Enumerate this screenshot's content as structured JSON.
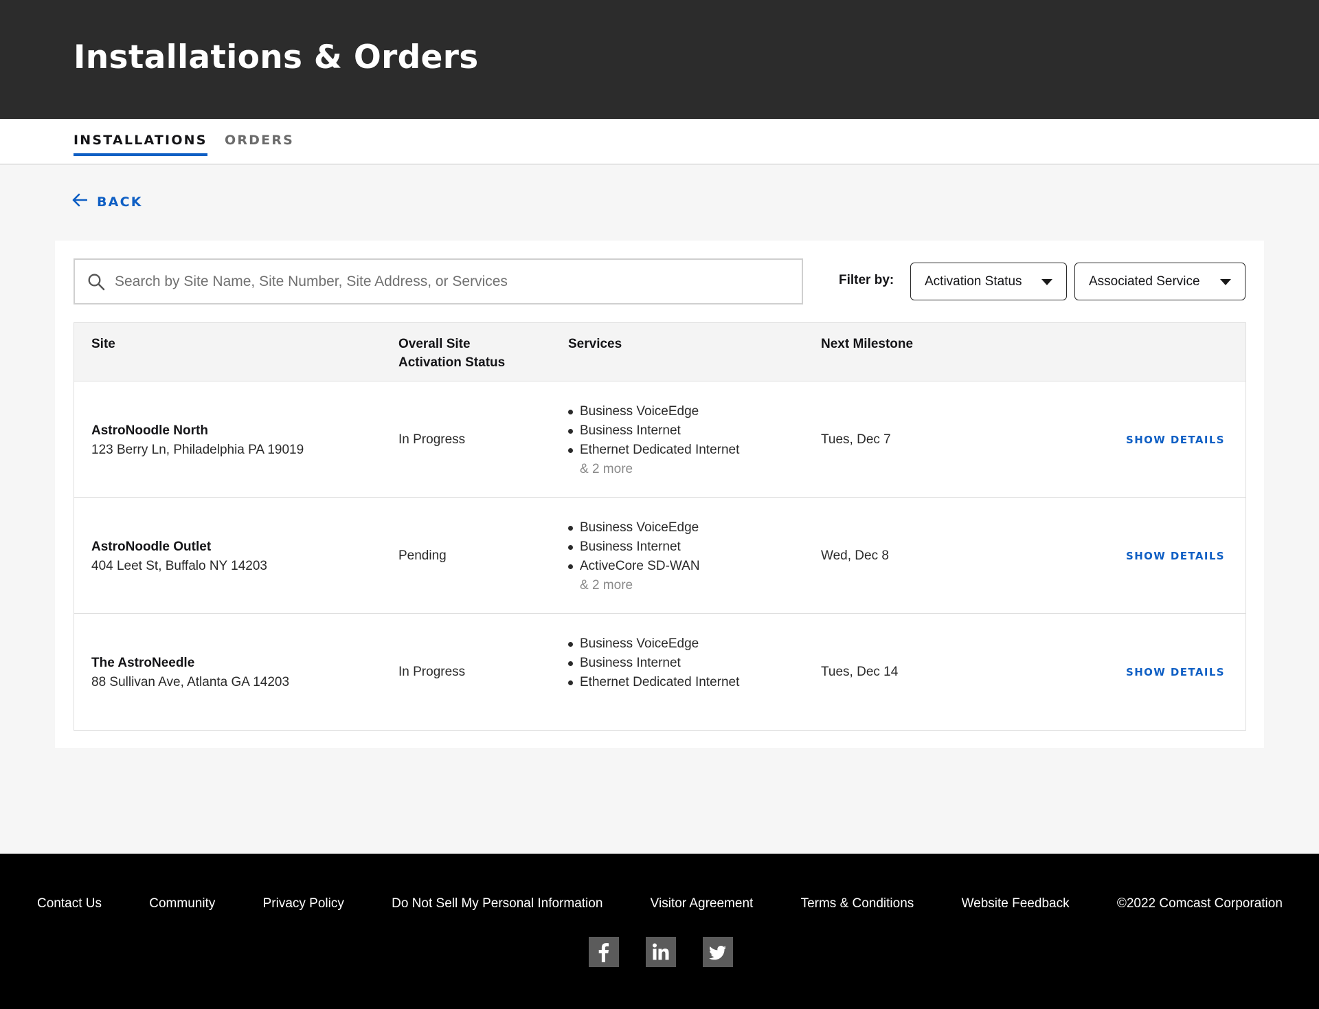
{
  "header": {
    "title": "Installations & Orders"
  },
  "tabs": [
    {
      "label": "INSTALLATIONS",
      "active": true
    },
    {
      "label": "ORDERS",
      "active": false
    }
  ],
  "back": {
    "label": "BACK",
    "icon": "arrow-left-icon"
  },
  "search": {
    "placeholder": "Search by Site Name, Site Number, Site Address, or Services",
    "value": "",
    "icon": "search-icon"
  },
  "filters": {
    "label": "Filter by:",
    "activation_status": {
      "value": "Activation Status",
      "icon": "caret-down-icon"
    },
    "associated_service": {
      "value": "Associated Service",
      "icon": "caret-down-icon"
    }
  },
  "table": {
    "columns": {
      "site": "Site",
      "status_line1": "Overall Site",
      "status_line2": "Activation Status",
      "services": "Services",
      "milestone": "Next Milestone"
    },
    "rows": [
      {
        "site_name": "AstroNoodle North",
        "address": "123 Berry Ln, Philadelphia PA 19019",
        "status": "In Progress",
        "services": [
          "Business VoiceEdge",
          "Business Internet",
          "Ethernet Dedicated Internet"
        ],
        "more": "& 2 more",
        "milestone": "Tues, Dec 7",
        "action": "SHOW DETAILS"
      },
      {
        "site_name": "AstroNoodle Outlet",
        "address": "404 Leet St, Buffalo NY 14203",
        "status": "Pending",
        "services": [
          "Business VoiceEdge",
          "Business Internet",
          "ActiveCore SD-WAN"
        ],
        "more": "& 2 more",
        "milestone": "Wed, Dec 8",
        "action": "SHOW DETAILS"
      },
      {
        "site_name": "The AstroNeedle",
        "address": "88 Sullivan Ave, Atlanta GA 14203",
        "status": "In Progress",
        "services": [
          "Business VoiceEdge",
          "Business Internet",
          "Ethernet Dedicated Internet"
        ],
        "more": "",
        "milestone": "Tues, Dec 14",
        "action": "SHOW DETAILS"
      }
    ]
  },
  "footer": {
    "links": [
      "Contact Us",
      "Community",
      "Privacy Policy",
      "Do Not Sell My Personal Information",
      "Visitor Agreement",
      "Terms & Conditions",
      "Website Feedback"
    ],
    "copyright": "©2022 Comcast Corporation",
    "social": [
      "facebook-icon",
      "linkedin-icon",
      "twitter-icon"
    ]
  },
  "colors": {
    "accent": "#0f5fc4",
    "header_bg": "#2c2c2c",
    "footer_bg": "#000000",
    "page_bg": "#f6f6f6"
  }
}
